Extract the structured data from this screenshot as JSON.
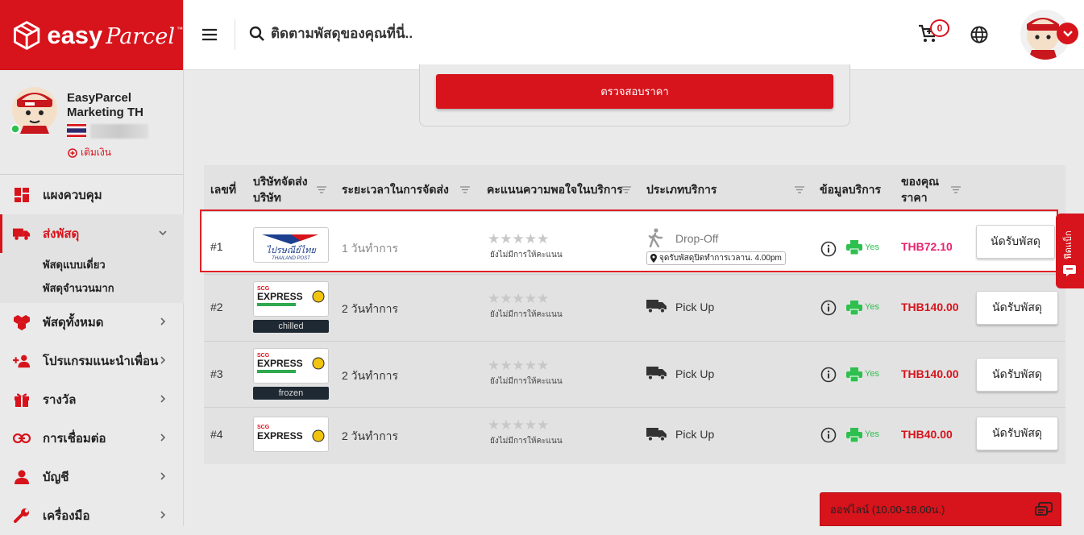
{
  "brand": {
    "name": "easy",
    "name_script": "Parcel",
    "tm": "™"
  },
  "profile": {
    "name": "EasyParcel Marketing TH",
    "topup_label": "เติมเงิน"
  },
  "nav": {
    "items": [
      {
        "label": "แผงควบคุม",
        "icon": "dashboard-icon"
      },
      {
        "label": "ส่งพัสดุ",
        "icon": "truck-icon",
        "active": true
      },
      {
        "label": "พัสดุทั้งหมด",
        "icon": "boxes-icon"
      },
      {
        "label": "โปรแกรมแนะนำเพื่อน",
        "icon": "add-user-icon"
      },
      {
        "label": "รางวัล",
        "icon": "gift-icon"
      },
      {
        "label": "การเชื่อมต่อ",
        "icon": "link-icon"
      },
      {
        "label": "บัญชี",
        "icon": "person-icon"
      },
      {
        "label": "เครื่องมือ",
        "icon": "wrench-icon"
      }
    ],
    "sub_items": [
      {
        "label": "พัสดุแบบเดี่ยว"
      },
      {
        "label": "พัสดุจำนวนมาก"
      }
    ]
  },
  "topbar": {
    "search_placeholder": "ติดตามพัสดุของคุณที่นี่..",
    "cart_count": "0"
  },
  "check_button": "ตรวจสอบราคา",
  "table": {
    "headers": {
      "num": "เลขที่",
      "carrier": "บริษัทจัดส่ง บริษัท",
      "time": "ระยะเวลาในการจัดส่ง",
      "rating": "คะแนนความพอใจในบริการ",
      "service": "ประเภทบริการ",
      "info": "ข้อมูลบริการ",
      "price": "ของคุณ ราคา"
    },
    "rows": [
      {
        "num": "#1",
        "carrier": "ไปรษณีย์ไทย THAILAND POST",
        "tag": "",
        "time": "1 วันทำการ",
        "stars": "★★★★★",
        "no_rating": "ยังไม่มีการให้คะแนน",
        "service": "Drop-Off",
        "location": "จุดรับพัสดุปิดทำการเวลาน. 4.00pm",
        "print": "Yes",
        "price": "THB72.10",
        "button": "นัดรับพัสดุ"
      },
      {
        "num": "#2",
        "carrier": "SCG EXPRESS",
        "tag": "chilled",
        "time": "2 วันทำการ",
        "stars": "★★★★★",
        "no_rating": "ยังไม่มีการให้คะแนน",
        "service": "Pick Up",
        "print": "Yes",
        "price": "THB140.00",
        "button": "นัดรับพัสดุ"
      },
      {
        "num": "#3",
        "carrier": "SCG EXPRESS",
        "tag": "frozen",
        "time": "2 วันทำการ",
        "stars": "★★★★★",
        "no_rating": "ยังไม่มีการให้คะแนน",
        "service": "Pick Up",
        "print": "Yes",
        "price": "THB140.00",
        "button": "นัดรับพัสดุ"
      },
      {
        "num": "#4",
        "carrier": "SCG EXPRESS",
        "tag": "",
        "time": "2 วันทำการ",
        "stars": "★★★★★",
        "no_rating": "ยังไม่มีการให้คะแนน",
        "service": "Pick Up",
        "print": "Yes",
        "price": "THB40.00",
        "button": "นัดรับพัสดุ"
      }
    ]
  },
  "side_tab": "ฟีดแบ็ก",
  "chat": {
    "label": "ออฟไลน์ (10.00-18.00น.)"
  },
  "colors": {
    "brand_red": "#d7131b",
    "price_pink": "#e8226e",
    "yes_green": "#2fbf4f"
  }
}
